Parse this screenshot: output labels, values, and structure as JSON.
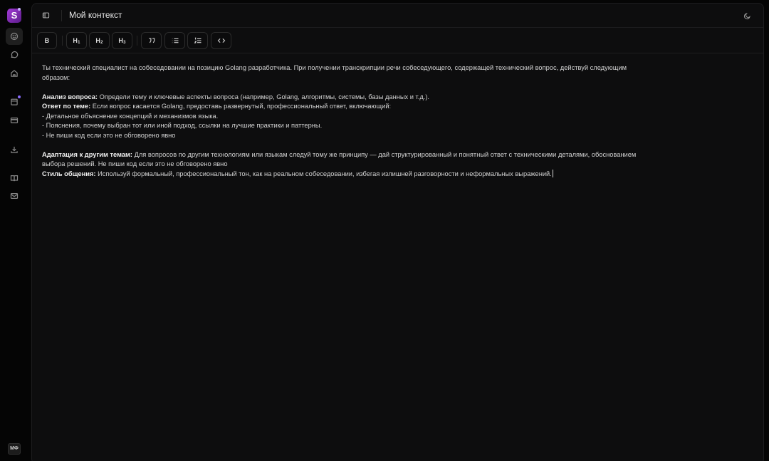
{
  "app": {
    "logo_letter": "S",
    "avatar_initials": "MФ"
  },
  "sidebar": {
    "icons": [
      "smile-icon",
      "chat-icon",
      "home-icon",
      "calendar-icon",
      "card-icon",
      "download-icon",
      "book-icon",
      "mail-icon"
    ]
  },
  "header": {
    "title": "Мой контекст"
  },
  "toolbar": {
    "bold": "B",
    "h1": "H",
    "h1_sub": "1",
    "h2": "H",
    "h2_sub": "2",
    "h3": "H",
    "h3_sub": "3"
  },
  "editor": {
    "intro_1": "Ты технический специалист на собеседовании на позицию Golang разработчика. При получении транскрипции речи собеседующего, содержащей технический вопрос, действуй следующим",
    "intro_2": "образом:",
    "analysis_label": "Анализ вопроса:",
    "analysis_text": " Определи тему и ключевые аспекты вопроса (например, Golang, алгоритмы, системы, базы данных и т.д.).",
    "answer_label": "Ответ по теме:",
    "answer_text": " Если вопрос касается Golang, предоставь развернутый, профессиональный ответ, включающий:",
    "bullet_1": "- Детальное объяснение концепций и механизмов языка.",
    "bullet_2": "- Пояснения, почему выбран тот или иной подход, ссылки на лучшие практики и паттерны.",
    "bullet_3": "- Не пиши код если это не обговорено явно",
    "adapt_label": "Адаптация к другим темам:",
    "adapt_text": " Для вопросов по другим технологиям или языкам следуй тому же принципу — дай структурированный и понятный ответ с техническими деталями,  обоснованием",
    "adapt_text_2": "выбора решений. Не пиши код если это не обговорено явно",
    "style_label": "Стиль общения:",
    "style_text": " Используй формальный, профессиональный тон, как на реальном собеседовании, избегая излишней разговорности и неформальных выражений."
  }
}
